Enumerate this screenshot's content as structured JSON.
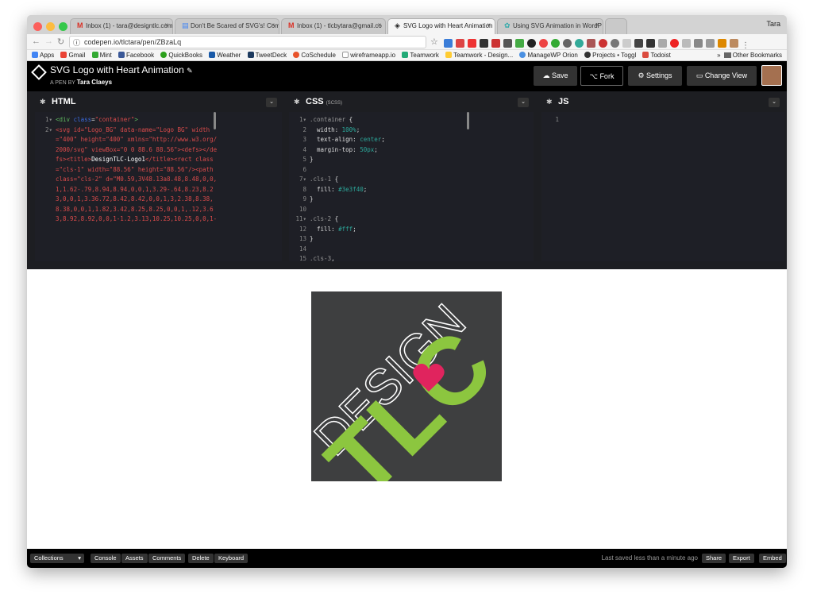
{
  "browser": {
    "user": "Tara",
    "tabs": [
      {
        "label": "Inbox (1) - tara@designtlc.com",
        "icon": "M"
      },
      {
        "label": "Don't Be Scared of SVG's! Com",
        "icon": "▤"
      },
      {
        "label": "Inbox (1) - tlcbytara@gmail.co",
        "icon": "M"
      },
      {
        "label": "SVG Logo with Heart Animation",
        "icon": "◈"
      },
      {
        "label": "Using SVG Animation in WordP",
        "icon": "✿"
      }
    ],
    "url": "codepen.io/tlctara/pen/ZBzaLq",
    "bookmarks": [
      "Apps",
      "Gmail",
      "Mint",
      "Facebook",
      "QuickBooks",
      "Weather",
      "TweetDeck",
      "CoSchedule",
      "wireframeapp.io",
      "Teamwork",
      "Teamwork - Design...",
      "ManageWP Orion",
      "Projects • Toggl",
      "Todoist"
    ],
    "other_bookmarks": "Other Bookmarks"
  },
  "pen": {
    "title": "SVG Logo with Heart Animation",
    "by_label": "A PEN BY",
    "author": "Tara Claeys",
    "buttons": {
      "save": "Save",
      "fork": "Fork",
      "settings": "Settings",
      "change_view": "Change View"
    }
  },
  "editors": {
    "html": {
      "name": "HTML",
      "line_numbers": "1▾\n2▾",
      "line1_tag": "<div",
      "line1_attr": "class",
      "line1_val": "\"container\"",
      "line2_code": "<svg id=\"Logo_BG\" data-name=\"Logo BG\" width=\"400\" height=\"400\" xmlns=\"http://www.w3.org/2000/svg\" viewBox=\"0 0 88.6 88.56\"><defs></defs><title>",
      "line2_title": "DesignTLC-Logo1",
      "line2_rest": "</title><rect class=\"cls-1\" width=\"88.56\" height=\"88.56\"/><path class=\"cls-2\" d=\"M0.59,3V48.13a8.48,8.48,0,0,1,1.62-.79,8.94,8.94,0,0,1,3.29-.64,8.23,8.23,0,0,1,3.36.72,8.42,8.42,0,0,1,3,2.38,8.38,8.38,0,0,1,1.82,3.42,8.25,8.25,0,0,1,.12,3.63,8.92,8.92,0,0,1-1.2,3.13,10.25,10.25,0,0,1-"
    },
    "css": {
      "name": "CSS",
      "sub": "(SCSS)",
      "line_numbers": "1▾\n2\n3\n4\n5\n6\n7▾\n8\n9\n10\n11▾\n12\n13\n14\n15",
      "lines": [
        {
          "sel": ".container",
          "rest": " {"
        },
        {
          "prop": "  width",
          "val": "100%"
        },
        {
          "prop": "  text-align",
          "val": "center"
        },
        {
          "prop": "  margin-top",
          "val": "50px"
        },
        {
          "plain": "}"
        },
        {
          "plain": ""
        },
        {
          "sel": ".cls-1",
          "rest": " {"
        },
        {
          "prop": "  fill",
          "val": "#3e3f40"
        },
        {
          "plain": "}"
        },
        {
          "plain": ""
        },
        {
          "sel": ".cls-2",
          "rest": " {"
        },
        {
          "prop": "  fill",
          "val": "#fff"
        },
        {
          "plain": "}"
        },
        {
          "plain": ""
        },
        {
          "sel": ".cls-3",
          "rest": ","
        }
      ]
    },
    "js": {
      "name": "JS",
      "line_numbers": "1"
    }
  },
  "logo": {
    "word": "DESIGN",
    "mark": "TLC",
    "colors": {
      "bg": "#3e3f40",
      "green": "#8cc63f",
      "heart": "#e0245e",
      "white": "#ffffff"
    }
  },
  "footer": {
    "collections": "Collections",
    "buttons": [
      "Console",
      "Assets",
      "Comments",
      "Delete",
      "Keyboard"
    ],
    "saved": "Last saved less than a minute ago",
    "right_buttons": [
      "Share",
      "Export",
      "Embed"
    ]
  }
}
